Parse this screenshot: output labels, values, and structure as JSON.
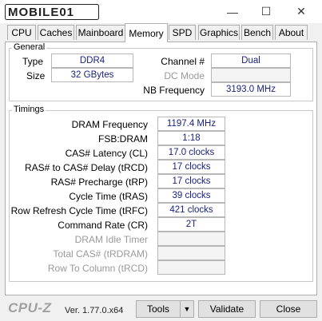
{
  "window": {
    "logo_text": "MOBILE01"
  },
  "tabs": [
    "CPU",
    "Caches",
    "Mainboard",
    "Memory",
    "SPD",
    "Graphics",
    "Bench",
    "About"
  ],
  "active_tab": "Memory",
  "general": {
    "legend": "General",
    "type_label": "Type",
    "type_value": "DDR4",
    "size_label": "Size",
    "size_value": "32 GBytes",
    "channel_label": "Channel #",
    "channel_value": "Dual",
    "dcmode_label": "DC Mode",
    "dcmode_value": "",
    "nbfreq_label": "NB Frequency",
    "nbfreq_value": "3193.0 MHz"
  },
  "timings": {
    "legend": "Timings",
    "rows": [
      {
        "label": "DRAM Frequency",
        "value": "1197.4 MHz"
      },
      {
        "label": "FSB:DRAM",
        "value": "1:18"
      },
      {
        "label": "CAS# Latency (CL)",
        "value": "17.0 clocks"
      },
      {
        "label": "RAS# to CAS# Delay (tRCD)",
        "value": "17 clocks"
      },
      {
        "label": "RAS# Precharge (tRP)",
        "value": "17 clocks"
      },
      {
        "label": "Cycle Time (tRAS)",
        "value": "39 clocks"
      },
      {
        "label": "Row Refresh Cycle Time (tRFC)",
        "value": "421 clocks"
      },
      {
        "label": "Command Rate (CR)",
        "value": "2T"
      },
      {
        "label": "DRAM Idle Timer",
        "value": ""
      },
      {
        "label": "Total CAS# (tRDRAM)",
        "value": ""
      },
      {
        "label": "Row To Column (tRCD)",
        "value": ""
      }
    ]
  },
  "footer": {
    "brand": "CPU-Z",
    "version": "Ver. 1.77.0.x64",
    "tools_label": "Tools",
    "validate_label": "Validate",
    "close_label": "Close"
  }
}
